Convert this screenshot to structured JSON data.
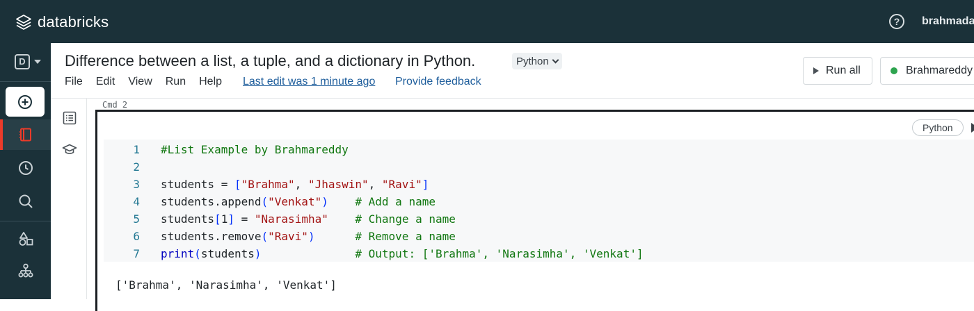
{
  "app": {
    "brand": "databricks",
    "user": "brahmada",
    "help_icon": "question-circle-icon"
  },
  "sidebar": {
    "workspace_letter": "D",
    "items": [
      {
        "name": "new",
        "icon": "plus-circle-icon"
      },
      {
        "name": "workspace",
        "icon": "notebook-icon",
        "active": true
      },
      {
        "name": "recents",
        "icon": "clock-icon"
      },
      {
        "name": "search",
        "icon": "search-icon"
      },
      {
        "name": "catalog",
        "icon": "shapes-icon"
      },
      {
        "name": "workflows",
        "icon": "workflow-icon"
      }
    ]
  },
  "notebook": {
    "title": "Difference between a list, a tuple, and a dictionary in Python.",
    "language": "Python",
    "menu": [
      "File",
      "Edit",
      "View",
      "Run",
      "Help"
    ],
    "last_edit": "Last edit was 1 minute ago",
    "feedback": "Provide feedback",
    "run_all": "Run all",
    "cluster": "Brahmareddy",
    "cluster_status_color": "#2ea44f"
  },
  "cell": {
    "cmd_label": "Cmd 2",
    "language": "Python",
    "lines": [
      {
        "n": "1",
        "tokens": [
          {
            "t": "#List Example by Brahmareddy",
            "c": "com"
          }
        ]
      },
      {
        "n": "2",
        "tokens": []
      },
      {
        "n": "3",
        "tokens": [
          {
            "t": "students = ",
            "c": "fn"
          },
          {
            "t": "[",
            "c": "br"
          },
          {
            "t": "\"Brahma\"",
            "c": "str"
          },
          {
            "t": ", ",
            "c": "fn"
          },
          {
            "t": "\"Jhaswin\"",
            "c": "str"
          },
          {
            "t": ", ",
            "c": "fn"
          },
          {
            "t": "\"Ravi\"",
            "c": "str"
          },
          {
            "t": "]",
            "c": "br"
          }
        ]
      },
      {
        "n": "4",
        "tokens": [
          {
            "t": "students.append",
            "c": "fn"
          },
          {
            "t": "(",
            "c": "br"
          },
          {
            "t": "\"Venkat\"",
            "c": "str"
          },
          {
            "t": ")",
            "c": "br"
          },
          {
            "t": "    ",
            "c": "fn"
          },
          {
            "t": "# Add a name",
            "c": "com"
          }
        ]
      },
      {
        "n": "5",
        "tokens": [
          {
            "t": "students",
            "c": "fn"
          },
          {
            "t": "[",
            "c": "br"
          },
          {
            "t": "1",
            "c": "fn"
          },
          {
            "t": "]",
            "c": "br"
          },
          {
            "t": " = ",
            "c": "fn"
          },
          {
            "t": "\"Narasimha\"",
            "c": "str"
          },
          {
            "t": "    ",
            "c": "fn"
          },
          {
            "t": "# Change a name",
            "c": "com"
          }
        ]
      },
      {
        "n": "6",
        "tokens": [
          {
            "t": "students.remove",
            "c": "fn"
          },
          {
            "t": "(",
            "c": "br"
          },
          {
            "t": "\"Ravi\"",
            "c": "str"
          },
          {
            "t": ")",
            "c": "br"
          },
          {
            "t": "      ",
            "c": "fn"
          },
          {
            "t": "# Remove a name",
            "c": "com"
          }
        ]
      },
      {
        "n": "7",
        "tokens": [
          {
            "t": "print",
            "c": "builtin"
          },
          {
            "t": "(",
            "c": "br"
          },
          {
            "t": "students",
            "c": "fn"
          },
          {
            "t": ")",
            "c": "br"
          },
          {
            "t": "              ",
            "c": "fn"
          },
          {
            "t": "# Output: ['Brahma', 'Narasimha', 'Venkat']",
            "c": "com"
          }
        ]
      }
    ],
    "output": "['Brahma', 'Narasimha', 'Venkat']"
  }
}
